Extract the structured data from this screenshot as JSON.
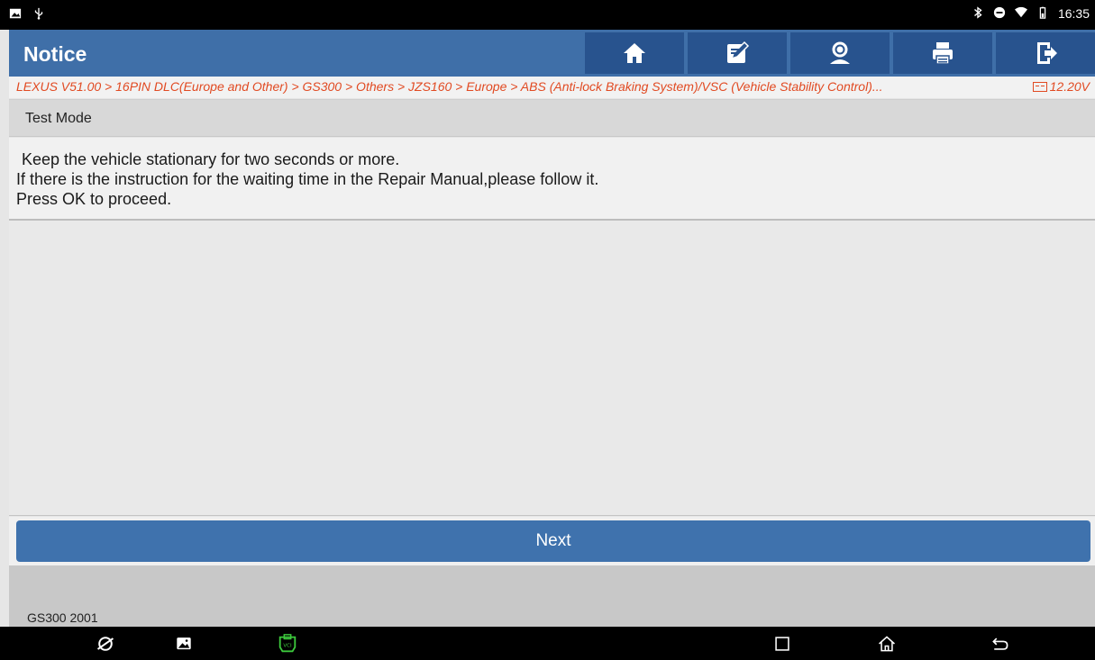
{
  "status_bar": {
    "time": "16:35",
    "icons": [
      "gallery-icon",
      "usb-icon",
      "bluetooth-icon",
      "dnd-icon",
      "wifi-icon",
      "battery-icon"
    ]
  },
  "titlebar": {
    "title": "Notice",
    "buttons": [
      {
        "name": "home-icon"
      },
      {
        "name": "edit-report-icon"
      },
      {
        "name": "remote-support-icon"
      },
      {
        "name": "print-icon"
      },
      {
        "name": "exit-icon"
      }
    ]
  },
  "breadcrumb": {
    "path": "LEXUS V51.00 > 16PIN DLC(Europe and Other) > GS300 > Others > JZS160 > Europe > ABS (Anti-lock Braking System)/VSC (Vehicle Stability Control)...",
    "voltage": "12.20V"
  },
  "section": {
    "title": "Test Mode"
  },
  "message": {
    "line1": "Keep the vehicle stationary for two seconds or more.",
    "line2": "If there is the instruction for the waiting time in the Repair Manual,please follow it.",
    "line3": "Press OK to proceed."
  },
  "actions": {
    "next_label": "Next"
  },
  "footer": {
    "vehicle": "GS300 2001"
  },
  "colors": {
    "titlebar": "#3f6fa8",
    "toolbar_button": "#28538e",
    "breadcrumb_text": "#e14a22",
    "next_button": "#3f72ad",
    "vci_icon": "#3cc83c"
  }
}
